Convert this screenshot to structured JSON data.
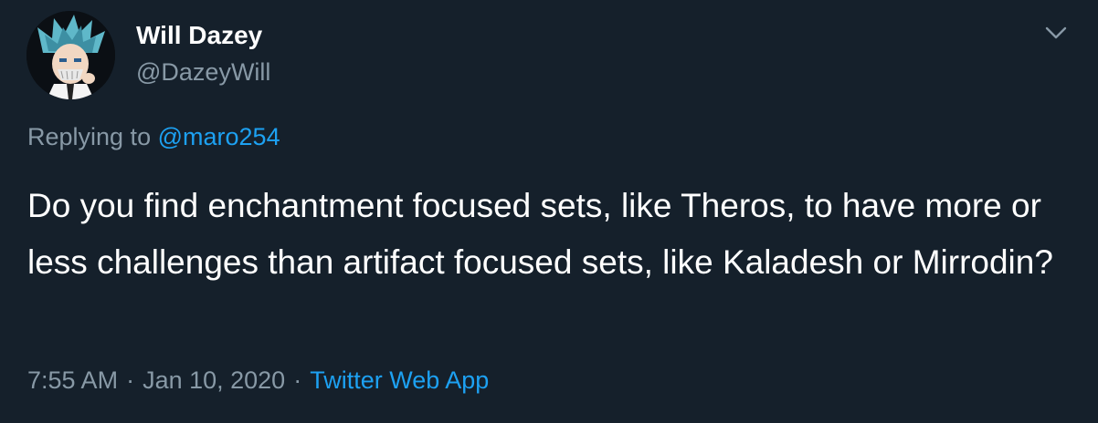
{
  "author": {
    "display_name": "Will Dazey",
    "handle": "@DazeyWill",
    "avatar_icon": "anime-character-avatar"
  },
  "reply": {
    "prefix": "Replying to",
    "mention": "@maro254"
  },
  "tweet": {
    "text": "Do you find enchantment focused sets, like Theros, to have more or less challenges than artifact focused sets, like Kaladesh or Mirrodin?"
  },
  "meta": {
    "time": "7:55 AM",
    "separator": "·",
    "date": "Jan 10, 2020",
    "source": "Twitter Web App"
  },
  "menu": {
    "icon": "chevron-down-icon"
  },
  "colors": {
    "background": "#15202b",
    "primary_text": "#ffffff",
    "secondary_text": "#8899a6",
    "accent": "#1da1f2"
  }
}
